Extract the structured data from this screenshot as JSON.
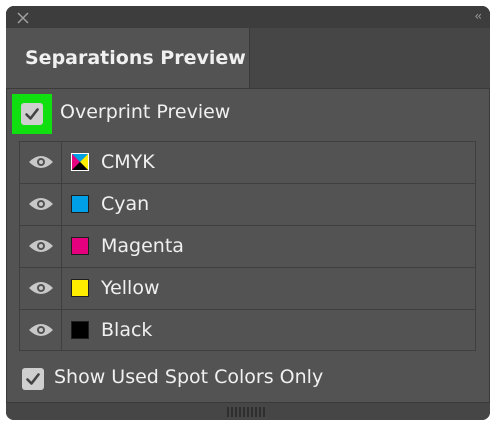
{
  "panel": {
    "tab_title": "Separations Preview"
  },
  "overprint": {
    "label": "Overprint Preview",
    "checked": true,
    "highlight_color": "#10e010"
  },
  "separations": [
    {
      "name": "CMYK",
      "color": "composite",
      "visible": true
    },
    {
      "name": "Cyan",
      "color": "#00a0e6",
      "visible": true
    },
    {
      "name": "Magenta",
      "color": "#e6007e",
      "visible": true
    },
    {
      "name": "Yellow",
      "color": "#ffee00",
      "visible": true
    },
    {
      "name": "Black",
      "color": "#000000",
      "visible": true
    }
  ],
  "spot_colors": {
    "label": "Show Used Spot Colors Only",
    "checked": true
  },
  "icons": {
    "close": "close-icon",
    "collapse": "collapse-panel-icon",
    "eye": "eye-icon",
    "check": "checkmark-icon",
    "grip": "resize-grip-icon"
  }
}
